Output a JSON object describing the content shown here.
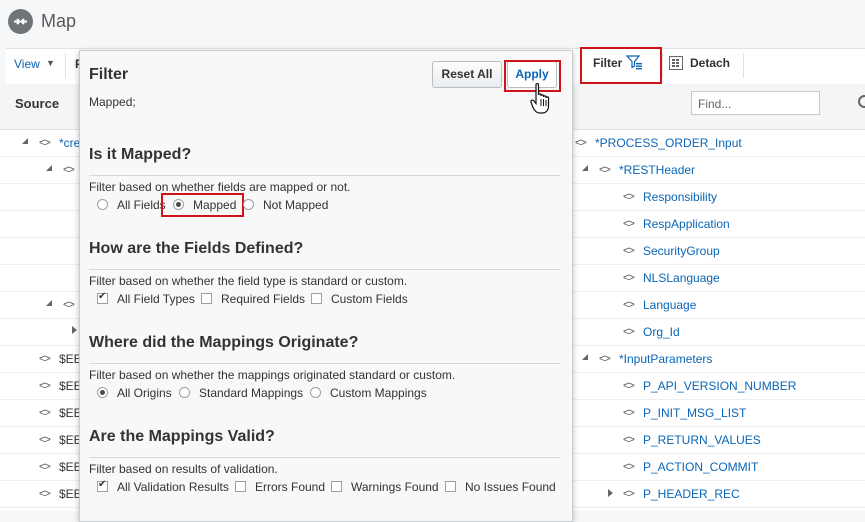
{
  "header": {
    "title": "Map",
    "icon": "map-icon"
  },
  "toolbar": {
    "view_label": "View",
    "truncated_label": "F",
    "filter_label": "Filter",
    "detach_label": "Detach"
  },
  "columns": {
    "source_label": "Source",
    "find_placeholder": "Find..."
  },
  "source_tree": {
    "row1": "*cre",
    "var_rows": [
      "$EE",
      "$EE",
      "$EE",
      "$EE",
      "$EE",
      "$EE"
    ]
  },
  "target_tree": [
    {
      "text": "*PROCESS_ORDER_Input"
    },
    {
      "text": "*RESTHeader"
    },
    {
      "text": "Responsibility"
    },
    {
      "text": "RespApplication"
    },
    {
      "text": "SecurityGroup"
    },
    {
      "text": "NLSLanguage"
    },
    {
      "text": "Language"
    },
    {
      "text": "Org_Id"
    },
    {
      "text": "*InputParameters"
    },
    {
      "text": "P_API_VERSION_NUMBER"
    },
    {
      "text": "P_INIT_MSG_LIST"
    },
    {
      "text": "P_RETURN_VALUES"
    },
    {
      "text": "P_ACTION_COMMIT"
    },
    {
      "text": "P_HEADER_REC"
    }
  ],
  "filter_popup": {
    "title": "Filter",
    "summary": "Mapped;",
    "reset_label": "Reset All",
    "apply_label": "Apply",
    "sections": [
      {
        "heading": "Is it Mapped?",
        "description": "Filter based on whether fields are mapped or not.",
        "options": [
          {
            "label": "All Fields",
            "checked": false
          },
          {
            "label": "Mapped",
            "checked": true
          },
          {
            "label": "Not Mapped",
            "checked": false
          }
        ]
      },
      {
        "heading": "How are the Fields Defined?",
        "description": "Filter based on whether the field type is standard or custom.",
        "options": [
          {
            "label": "All Field Types",
            "checked": true
          },
          {
            "label": "Required Fields",
            "checked": false
          },
          {
            "label": "Custom Fields",
            "checked": false
          }
        ]
      },
      {
        "heading": "Where did the Mappings Originate?",
        "description": "Filter based on whether the mappings originated standard or custom.",
        "options": [
          {
            "label": "All Origins",
            "checked": true
          },
          {
            "label": "Standard Mappings",
            "checked": false
          },
          {
            "label": "Custom Mappings",
            "checked": false
          }
        ]
      },
      {
        "heading": "Are the Mappings Valid?",
        "description": "Filter based on results of validation.",
        "options": [
          {
            "label": "All Validation Results",
            "checked": true
          },
          {
            "label": "Errors Found",
            "checked": false
          },
          {
            "label": "Warnings Found",
            "checked": false
          },
          {
            "label": "No Issues Found",
            "checked": false
          }
        ]
      }
    ]
  },
  "colors": {
    "link": "#0a65b6",
    "highlight": "#d0121b"
  }
}
